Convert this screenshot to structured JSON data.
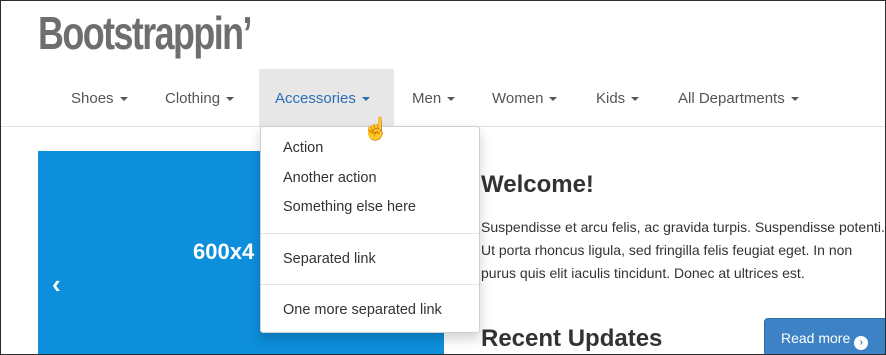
{
  "brand": "Bootstrappin’",
  "nav": {
    "items": [
      {
        "label": "Shoes"
      },
      {
        "label": "Clothing"
      },
      {
        "label": "Accessories"
      },
      {
        "label": "Men"
      },
      {
        "label": "Women"
      },
      {
        "label": "Kids"
      },
      {
        "label": "All Departments"
      }
    ],
    "active_index": 2
  },
  "dropdown": {
    "items": [
      "Action",
      "Another action",
      "Something else here",
      "Separated link",
      "One more separated link"
    ]
  },
  "hero": {
    "placeholder_text": "600x4",
    "prev_arrow": "‹",
    "color": "#0d8fdb"
  },
  "main": {
    "welcome_heading": "Welcome!",
    "paragraph": "Suspendisse et arcu felis, ac gravida turpis. Suspendisse potenti. Ut porta rhoncus ligula, sed fringilla felis feugiat eget. In non purus quis elit iaculis tincidunt. Donec at ultrices est.",
    "recent_heading": "Recent Updates",
    "read_more_label": "Read more"
  },
  "colors": {
    "accent": "#3c82c5",
    "active_nav_text": "#2a6fb5"
  }
}
